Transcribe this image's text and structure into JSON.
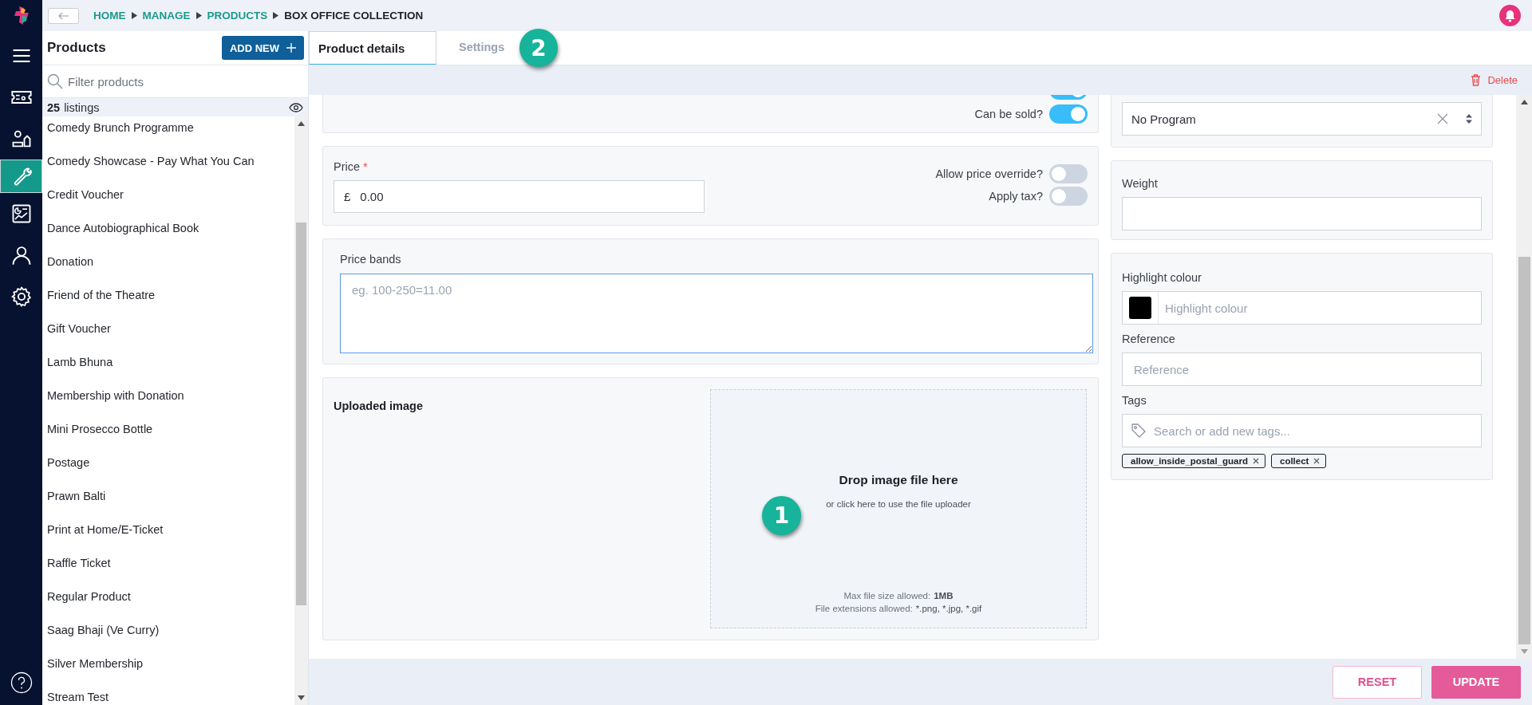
{
  "nav_items": [
    {
      "selected": false
    },
    {
      "selected": false
    },
    {
      "selected": false
    },
    {
      "selected": true
    },
    {
      "selected": false
    },
    {
      "selected": false
    },
    {
      "selected": false
    }
  ],
  "breadcrumb": [
    {
      "label": "HOME",
      "kind": "link"
    },
    {
      "label": "MANAGE",
      "kind": "link"
    },
    {
      "label": "PRODUCTS",
      "kind": "link"
    },
    {
      "label": "BOX OFFICE COLLECTION",
      "kind": "current"
    }
  ],
  "products_panel": {
    "title": "Products",
    "add_button": "ADD NEW",
    "filter_placeholder": "Filter products",
    "listing_count": "25",
    "listing_label": "listings",
    "items": [
      "Comedy Brunch Programme",
      "Comedy Showcase - Pay What You Can",
      "Credit Voucher",
      "Dance Autobiographical Book",
      "Donation",
      "Friend of the Theatre",
      "Gift Voucher",
      "Lamb Bhuna",
      "Membership with Donation",
      "Mini Prosecco Bottle",
      "Postage",
      "Prawn Balti",
      "Print at Home/E-Ticket",
      "Raffle Ticket",
      "Regular Product",
      "Saag Bhaji (Ve Curry)",
      "Silver Membership",
      "Stream Test"
    ]
  },
  "tabs": [
    {
      "label": "Product details",
      "selected": true
    },
    {
      "label": "Settings",
      "selected": false
    }
  ],
  "tabs_annotation": "2",
  "delete_label": "Delete",
  "sales_card": {
    "toggles": [
      {
        "on": true
      },
      {
        "label": "Can be sold?",
        "on": true
      }
    ]
  },
  "price": {
    "label": "Price",
    "required": true,
    "required_mark": "*",
    "currency": "£",
    "value": "0.00",
    "toggles": [
      {
        "label": "Allow price override?",
        "on": false
      },
      {
        "label": "Apply tax?",
        "on": false
      }
    ]
  },
  "price_bands": {
    "label": "Price bands",
    "placeholder": "eg. 100-250=11.00"
  },
  "upload": {
    "label": "Uploaded image",
    "title": "Drop image file here",
    "subtitle": "or click here to use the file uploader",
    "max_size_label": "Max file size allowed:",
    "max_size": "1MB",
    "extensions_label": "File extensions allowed:",
    "extensions": "*.png, *.jpg, *.gif",
    "annotation": "1"
  },
  "program": {
    "value": "No Program"
  },
  "weight": {
    "label": "Weight"
  },
  "highlight": {
    "label": "Highlight colour",
    "color": "#000000",
    "placeholder": "Highlight colour"
  },
  "reference": {
    "label": "Reference",
    "placeholder": "Reference"
  },
  "tags": {
    "label": "Tags",
    "placeholder": "Search or add new tags...",
    "items": [
      "allow_inside_postal_guard",
      "collect"
    ]
  },
  "footer_buttons": [
    {
      "label": "RESET",
      "kind": "secondary",
      "disabled": true
    },
    {
      "label": "UPDATE",
      "kind": "primary",
      "disabled": true
    }
  ]
}
